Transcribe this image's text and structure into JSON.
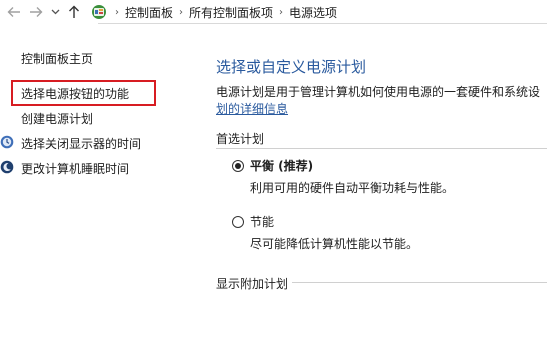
{
  "nav": {
    "breadcrumbs": [
      "控制面板",
      "所有控制面板项",
      "电源选项"
    ],
    "separator": "›"
  },
  "left_pane": {
    "home_link": "控制面板主页",
    "items": [
      {
        "label": "选择电源按钮的功能",
        "highlighted": true
      },
      {
        "label": "创建电源计划"
      },
      {
        "label": "选择关闭显示器的时间",
        "icon": "display-icon"
      },
      {
        "label": "更改计算机睡眠时间",
        "icon": "moon-icon"
      }
    ],
    "highlight_color": "#d71c22"
  },
  "main": {
    "title": "选择或自定义电源计划",
    "description": "电源计划是用于管理计算机如何使用电源的一套硬件和系统设",
    "description_link": "划的详细信息",
    "preferred_section": "首选计划",
    "plans": [
      {
        "name": "平衡 (推荐)",
        "description": "利用可用的硬件自动平衡功耗与性能。",
        "selected": true
      },
      {
        "name": "节能",
        "description": "尽可能降低计算机性能以节能。",
        "selected": false
      }
    ],
    "extra_section": "显示附加计划"
  },
  "colors": {
    "title_blue": "#2a5a9e",
    "link_blue": "#2a5a9e"
  }
}
